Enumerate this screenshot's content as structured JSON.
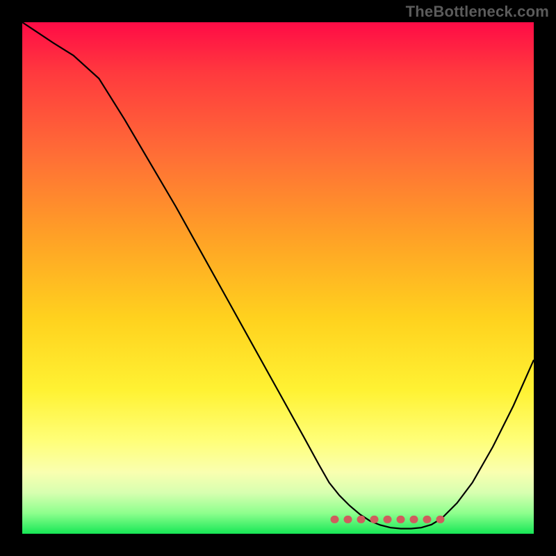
{
  "watermark": "TheBottleneck.com",
  "colors": {
    "background": "#000000",
    "curve": "#000000",
    "dots": "#cf5d5d",
    "gradient_top": "#ff0b46",
    "gradient_bottom": "#17e756"
  },
  "chart_data": {
    "type": "line",
    "title": "",
    "xlabel": "",
    "ylabel": "",
    "xlim": [
      0,
      100
    ],
    "ylim": [
      0,
      100
    ],
    "x": [
      0,
      3,
      6,
      10,
      15,
      20,
      25,
      30,
      35,
      40,
      45,
      50,
      55,
      58,
      60,
      62,
      64,
      66,
      68,
      70,
      72,
      74,
      76,
      78,
      80,
      82,
      85,
      88,
      92,
      96,
      100
    ],
    "y": [
      100,
      98,
      96,
      93.5,
      89,
      81,
      72.5,
      64,
      55,
      46,
      37,
      28,
      19,
      13.5,
      10,
      7.5,
      5.5,
      3.8,
      2.5,
      1.7,
      1.2,
      1.0,
      1.0,
      1.2,
      1.8,
      3.0,
      6.0,
      10,
      17,
      25,
      34
    ],
    "series": [
      {
        "name": "bottleneck-curve",
        "x": [
          0,
          3,
          6,
          10,
          15,
          20,
          25,
          30,
          35,
          40,
          45,
          50,
          55,
          58,
          60,
          62,
          64,
          66,
          68,
          70,
          72,
          74,
          76,
          78,
          80,
          82,
          85,
          88,
          92,
          96,
          100
        ],
        "y": [
          100,
          98,
          96,
          93.5,
          89,
          81,
          72.5,
          64,
          55,
          46,
          37,
          28,
          19,
          13.5,
          10,
          7.5,
          5.5,
          3.8,
          2.5,
          1.7,
          1.2,
          1.0,
          1.0,
          1.2,
          1.8,
          3.0,
          6.0,
          10,
          17,
          25,
          34
        ]
      }
    ],
    "highlight_band": {
      "x_start": 61,
      "x_end": 84,
      "y": 2.8
    }
  }
}
